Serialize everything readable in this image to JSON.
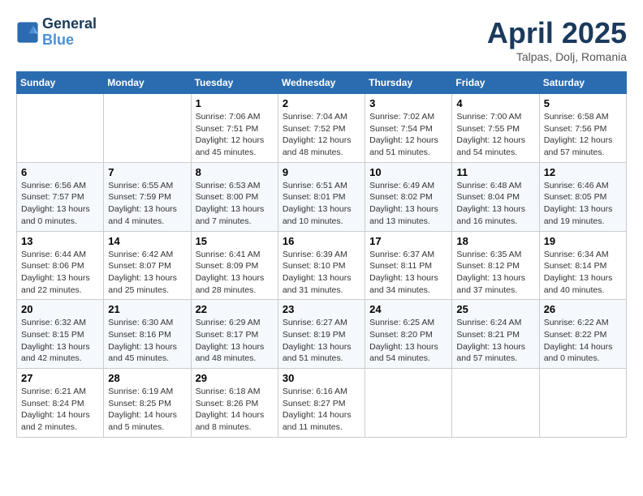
{
  "logo": {
    "line1": "General",
    "line2": "Blue"
  },
  "header": {
    "month": "April 2025",
    "location": "Talpas, Dolj, Romania"
  },
  "weekdays": [
    "Sunday",
    "Monday",
    "Tuesday",
    "Wednesday",
    "Thursday",
    "Friday",
    "Saturday"
  ],
  "weeks": [
    [
      {
        "day": "",
        "info": ""
      },
      {
        "day": "",
        "info": ""
      },
      {
        "day": "1",
        "info": "Sunrise: 7:06 AM\nSunset: 7:51 PM\nDaylight: 12 hours and 45 minutes."
      },
      {
        "day": "2",
        "info": "Sunrise: 7:04 AM\nSunset: 7:52 PM\nDaylight: 12 hours and 48 minutes."
      },
      {
        "day": "3",
        "info": "Sunrise: 7:02 AM\nSunset: 7:54 PM\nDaylight: 12 hours and 51 minutes."
      },
      {
        "day": "4",
        "info": "Sunrise: 7:00 AM\nSunset: 7:55 PM\nDaylight: 12 hours and 54 minutes."
      },
      {
        "day": "5",
        "info": "Sunrise: 6:58 AM\nSunset: 7:56 PM\nDaylight: 12 hours and 57 minutes."
      }
    ],
    [
      {
        "day": "6",
        "info": "Sunrise: 6:56 AM\nSunset: 7:57 PM\nDaylight: 13 hours and 0 minutes."
      },
      {
        "day": "7",
        "info": "Sunrise: 6:55 AM\nSunset: 7:59 PM\nDaylight: 13 hours and 4 minutes."
      },
      {
        "day": "8",
        "info": "Sunrise: 6:53 AM\nSunset: 8:00 PM\nDaylight: 13 hours and 7 minutes."
      },
      {
        "day": "9",
        "info": "Sunrise: 6:51 AM\nSunset: 8:01 PM\nDaylight: 13 hours and 10 minutes."
      },
      {
        "day": "10",
        "info": "Sunrise: 6:49 AM\nSunset: 8:02 PM\nDaylight: 13 hours and 13 minutes."
      },
      {
        "day": "11",
        "info": "Sunrise: 6:48 AM\nSunset: 8:04 PM\nDaylight: 13 hours and 16 minutes."
      },
      {
        "day": "12",
        "info": "Sunrise: 6:46 AM\nSunset: 8:05 PM\nDaylight: 13 hours and 19 minutes."
      }
    ],
    [
      {
        "day": "13",
        "info": "Sunrise: 6:44 AM\nSunset: 8:06 PM\nDaylight: 13 hours and 22 minutes."
      },
      {
        "day": "14",
        "info": "Sunrise: 6:42 AM\nSunset: 8:07 PM\nDaylight: 13 hours and 25 minutes."
      },
      {
        "day": "15",
        "info": "Sunrise: 6:41 AM\nSunset: 8:09 PM\nDaylight: 13 hours and 28 minutes."
      },
      {
        "day": "16",
        "info": "Sunrise: 6:39 AM\nSunset: 8:10 PM\nDaylight: 13 hours and 31 minutes."
      },
      {
        "day": "17",
        "info": "Sunrise: 6:37 AM\nSunset: 8:11 PM\nDaylight: 13 hours and 34 minutes."
      },
      {
        "day": "18",
        "info": "Sunrise: 6:35 AM\nSunset: 8:12 PM\nDaylight: 13 hours and 37 minutes."
      },
      {
        "day": "19",
        "info": "Sunrise: 6:34 AM\nSunset: 8:14 PM\nDaylight: 13 hours and 40 minutes."
      }
    ],
    [
      {
        "day": "20",
        "info": "Sunrise: 6:32 AM\nSunset: 8:15 PM\nDaylight: 13 hours and 42 minutes."
      },
      {
        "day": "21",
        "info": "Sunrise: 6:30 AM\nSunset: 8:16 PM\nDaylight: 13 hours and 45 minutes."
      },
      {
        "day": "22",
        "info": "Sunrise: 6:29 AM\nSunset: 8:17 PM\nDaylight: 13 hours and 48 minutes."
      },
      {
        "day": "23",
        "info": "Sunrise: 6:27 AM\nSunset: 8:19 PM\nDaylight: 13 hours and 51 minutes."
      },
      {
        "day": "24",
        "info": "Sunrise: 6:25 AM\nSunset: 8:20 PM\nDaylight: 13 hours and 54 minutes."
      },
      {
        "day": "25",
        "info": "Sunrise: 6:24 AM\nSunset: 8:21 PM\nDaylight: 13 hours and 57 minutes."
      },
      {
        "day": "26",
        "info": "Sunrise: 6:22 AM\nSunset: 8:22 PM\nDaylight: 14 hours and 0 minutes."
      }
    ],
    [
      {
        "day": "27",
        "info": "Sunrise: 6:21 AM\nSunset: 8:24 PM\nDaylight: 14 hours and 2 minutes."
      },
      {
        "day": "28",
        "info": "Sunrise: 6:19 AM\nSunset: 8:25 PM\nDaylight: 14 hours and 5 minutes."
      },
      {
        "day": "29",
        "info": "Sunrise: 6:18 AM\nSunset: 8:26 PM\nDaylight: 14 hours and 8 minutes."
      },
      {
        "day": "30",
        "info": "Sunrise: 6:16 AM\nSunset: 8:27 PM\nDaylight: 14 hours and 11 minutes."
      },
      {
        "day": "",
        "info": ""
      },
      {
        "day": "",
        "info": ""
      },
      {
        "day": "",
        "info": ""
      }
    ]
  ]
}
